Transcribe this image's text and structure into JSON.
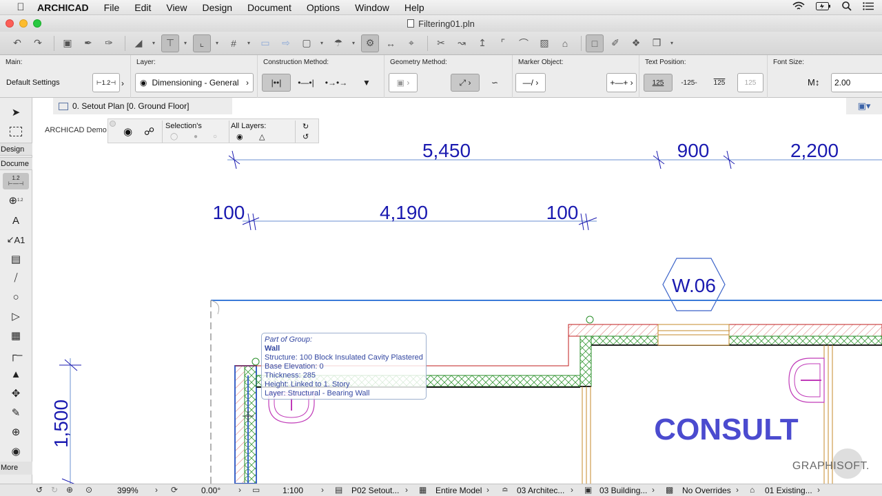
{
  "menubar": {
    "app_name": "ARCHICAD",
    "items": [
      "File",
      "Edit",
      "View",
      "Design",
      "Document",
      "Options",
      "Window",
      "Help"
    ]
  },
  "window": {
    "title": "Filtering01.pln"
  },
  "infobox": {
    "main": {
      "label": "Main:",
      "value": "Default Settings"
    },
    "layer": {
      "label": "Layer:",
      "value": "Dimensioning - General"
    },
    "construction": {
      "label": "Construction Method:"
    },
    "geometry": {
      "label": "Geometry Method:"
    },
    "marker": {
      "label": "Marker Object:"
    },
    "text_position": {
      "label": "Text Position:",
      "options": [
        "125",
        "-125-",
        "125",
        "125"
      ]
    },
    "font_size": {
      "label": "Font Size:",
      "value": "2.00"
    }
  },
  "toolbox": {
    "design_label": "Design",
    "document_label": "Docume",
    "more_label": "More",
    "dim_tool_text": "1.2",
    "level_tool_text": "1.2",
    "label_tool_text": "A1"
  },
  "navigator": {
    "view_name": "0. Setout Plan [0. Ground Floor]"
  },
  "quick_options": {
    "title": "ARCHICAD Demo",
    "selection_label": "Selection's",
    "all_layers_label": "All Layers:"
  },
  "drawing": {
    "dim_top": [
      "5,450",
      "900",
      "2,200"
    ],
    "dim_second": [
      "100",
      "4,190",
      "100"
    ],
    "dim_vertical": "1,500",
    "window_marker": "W.06",
    "room_name": "CONSULT"
  },
  "tooltip": {
    "group": "Part of Group:",
    "type": "Wall",
    "structure": "Structure: 100 Block Insulated Cavity Plastered",
    "base_elevation": "Base Elevation: 0",
    "thickness": "Thickness: 285",
    "height": "Height: Linked to 1. Story",
    "layer": "Layer: Structural - Bearing Wall"
  },
  "statusbar": {
    "zoom": "399%",
    "angle": "0.00°",
    "scale": "1:100",
    "layer_combo": "P02 Setout...",
    "model_view": "Entire Model",
    "pen_set": "03 Architec...",
    "dim_style": "03 Building...",
    "overrides": "No Overrides",
    "renovation": "01 Existing..."
  },
  "brand": "GRAPHISOFT.",
  "colors": {
    "dimension": "#1a1ab0",
    "wall": "#c01d1d",
    "hatch": "#2a8f2a",
    "fixture": "#c03ab8",
    "selection": "#3a62c8",
    "marker": "#3a62c8"
  }
}
